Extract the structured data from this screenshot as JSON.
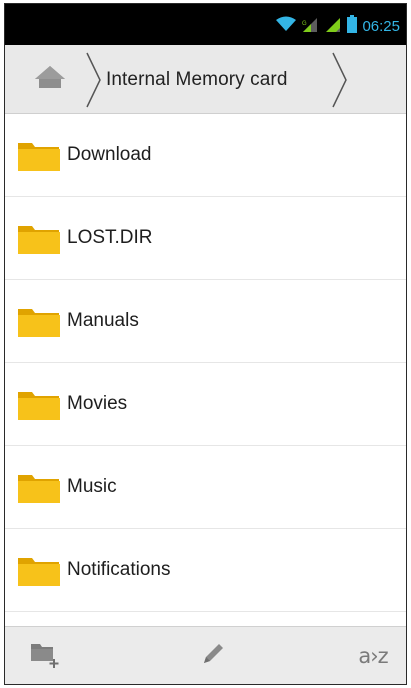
{
  "status_bar": {
    "time": "06:25",
    "icons": [
      "wifi-icon",
      "signal-1-icon",
      "signal-2-icon",
      "battery-icon"
    ],
    "accent_color": "#33b5e5",
    "signal_color": "#7fcc1a"
  },
  "breadcrumb": {
    "home_icon": "home-icon",
    "current_path": "Internal Memory card"
  },
  "folders": [
    {
      "name": "Download"
    },
    {
      "name": "LOST.DIR"
    },
    {
      "name": "Manuals"
    },
    {
      "name": "Movies"
    },
    {
      "name": "Music"
    },
    {
      "name": "Notifications"
    }
  ],
  "bottom_bar": {
    "new_folder_icon": "new-folder-icon",
    "edit_icon": "pencil-icon",
    "sort_label": "a›z"
  },
  "colors": {
    "folder_yellow": "#f7c21a",
    "folder_dark": "#e0a300"
  }
}
